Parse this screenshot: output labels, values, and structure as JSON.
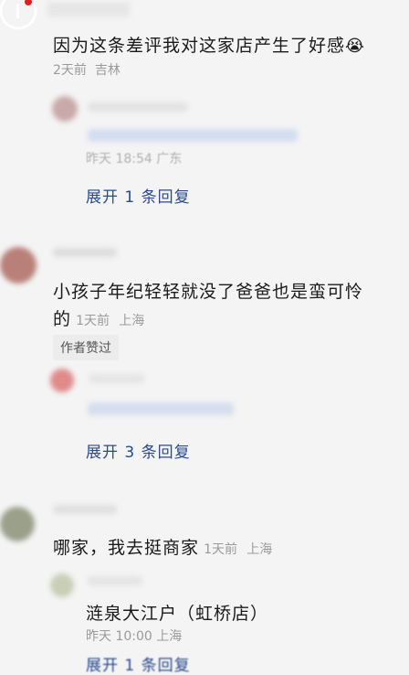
{
  "comments": [
    {
      "text": "因为这条差评我对这家店产生了好感",
      "emoji": "😭",
      "time": "2天前",
      "location": "吉林",
      "reply": {
        "meta": "昨天 18:54 广东"
      },
      "expand_label": "展开 1 条回复"
    },
    {
      "text_line1": "小孩子年纪轻轻就没了爸爸也是蛮可怜",
      "text_line2": "的",
      "time": "1天前",
      "location": "上海",
      "badge": "作者赞过",
      "expand_label": "展开 3 条回复"
    },
    {
      "text": "哪家，我去挺商家",
      "time": "1天前",
      "location": "上海",
      "reply": {
        "text": "涟泉大江户（虹桥店）",
        "meta": "昨天 10:00 上海"
      },
      "expand_label": "展开 1 条回复"
    }
  ],
  "colors": {
    "accent": "#2b4a8a",
    "live": "#e02020"
  },
  "icons": {
    "top_left": "live-record-icon"
  }
}
